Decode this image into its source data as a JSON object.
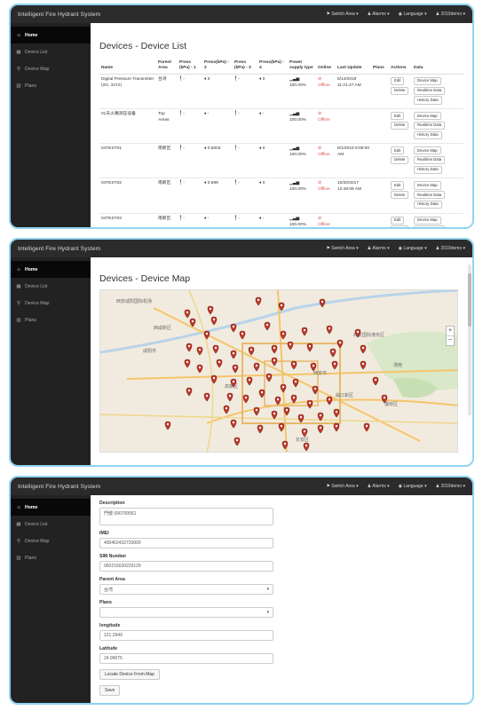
{
  "app": {
    "brand": "Intelligent Fire Hydrant System",
    "topnav": [
      "Switch Area ▾",
      "Alarms ▾",
      "Language ▾",
      "2019demo ▾"
    ],
    "sidebar": [
      {
        "label": "Home",
        "icon": "home-icon",
        "active": true
      },
      {
        "label": "Device List",
        "icon": "list-icon",
        "active": false
      },
      {
        "label": "Device Map",
        "icon": "map-marker-icon",
        "active": false
      },
      {
        "label": "Plans",
        "icon": "plans-icon",
        "active": false
      }
    ]
  },
  "device_list": {
    "title": "Devices - Device List",
    "headers": [
      "Name",
      "Parent Area",
      "Press (kPa) - 1",
      "Press(kPa) - 2",
      "Press (kPa) - 3",
      "Press(kPa) - 4",
      "Power supply type",
      "Online",
      "Last Update",
      "Plans",
      "Actions",
      "Data"
    ],
    "rows": [
      {
        "name": "Digital Pressure Transmitter (2G, 3272)",
        "area": "台湾",
        "p1": "-",
        "p2": "0",
        "p3": "-",
        "p4": "0",
        "power": "100.00%",
        "online": "Offline",
        "update": "5/14/2019 11:21:27 AM"
      },
      {
        "name": "01天火嘴测压设备",
        "area": "Top Areas",
        "p1": "-",
        "p2": "-",
        "p3": "-",
        "p4": "-",
        "power": "100.00%",
        "online": "Offline",
        "update": ""
      },
      {
        "name": "04TEST01",
        "area": "南新区",
        "p1": "-",
        "p2": "0.5003",
        "p3": "-",
        "p4": "0",
        "power": "100.00%",
        "online": "Offline",
        "update": "8/1/2019 9:09:00 AM"
      },
      {
        "name": "04TEST02",
        "area": "南新区",
        "p1": "-",
        "p2": "0.699",
        "p3": "-",
        "p4": "0",
        "power": "100.00%",
        "online": "Offline",
        "update": "10/20/2017 12:48:06 AM"
      },
      {
        "name": "04TEST03",
        "area": "南新区",
        "p1": "-",
        "p2": "-",
        "p3": "-",
        "p4": "-",
        "power": "100.00%",
        "online": "Offline",
        "update": ""
      }
    ],
    "actions": [
      "Edit",
      "Delete"
    ],
    "data_buttons": [
      "Device Map",
      "Realtime Data",
      "History Data"
    ]
  },
  "device_map": {
    "title": "Devices - Device Map",
    "zoom_in": "+",
    "zoom_out": "−",
    "labels": [
      "西安咸阳国际机场",
      "西咸新区",
      "咸阳市",
      "西安市",
      "渭南",
      "西安国际港务区",
      "曲江新区",
      "长安区",
      "高新区",
      "灞桥区"
    ]
  },
  "device_form": {
    "fields": [
      {
        "label": "Description",
        "value": "門號 090709561",
        "kind": "textarea"
      },
      {
        "label": "IMEI",
        "value": "400452432720000",
        "kind": "input"
      },
      {
        "label": "SIM Number",
        "value": "050215020229129",
        "kind": "input"
      },
      {
        "label": "Parent Area",
        "value": "台湾",
        "kind": "select"
      },
      {
        "label": "Plans",
        "value": "",
        "kind": "select"
      },
      {
        "label": "longitude",
        "value": "121.2949",
        "kind": "input"
      },
      {
        "label": "Latitude",
        "value": "24.99075",
        "kind": "input"
      }
    ],
    "locate_button": "Locate Device From Map",
    "save_button": "Save"
  }
}
